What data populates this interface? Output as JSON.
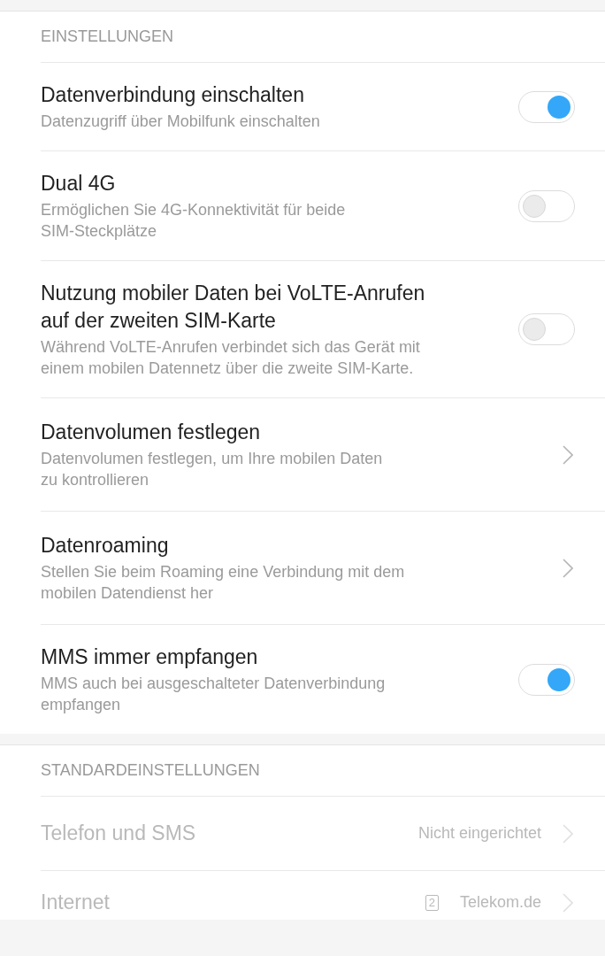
{
  "sections": [
    {
      "header": "EINSTELLUNGEN",
      "items": [
        {
          "kind": "toggle",
          "title": "Datenverbindung einschalten",
          "subtitle": "Datenzugriff über Mobilfunk einschalten",
          "on": true
        },
        {
          "kind": "toggle",
          "title": "Dual 4G",
          "subtitle": "Ermöglichen Sie 4G-Konnektivität für beide\nSIM-Steckplätze",
          "on": false
        },
        {
          "kind": "toggle",
          "title": "Nutzung mobiler Daten bei VoLTE-Anrufen\nauf der zweiten SIM-Karte",
          "subtitle": "Während VoLTE-Anrufen verbindet sich das Gerät mit\neinem mobilen Datennetz über die zweite SIM-Karte.",
          "on": false
        },
        {
          "kind": "link",
          "title": "Datenvolumen festlegen",
          "subtitle": "Datenvolumen festlegen, um Ihre mobilen Daten\nzu kontrollieren",
          "disabled": false
        },
        {
          "kind": "link",
          "title": "Datenroaming",
          "subtitle": "Stellen Sie beim Roaming eine Verbindung mit dem\nmobilen Datendienst her",
          "disabled": false
        },
        {
          "kind": "toggle",
          "title": "MMS immer empfangen",
          "subtitle": "MMS auch bei ausgeschalteter Datenverbindung\nempfangen",
          "on": true
        }
      ]
    },
    {
      "header": "STANDARDEINSTELLUNGEN",
      "items": [
        {
          "kind": "value",
          "title": "Telefon und SMS",
          "value": "Nicht eingerichtet",
          "disabled": true
        },
        {
          "kind": "value",
          "title": "Internet",
          "value": "Telekom.de",
          "sim_badge": "2",
          "disabled": true
        }
      ]
    }
  ]
}
